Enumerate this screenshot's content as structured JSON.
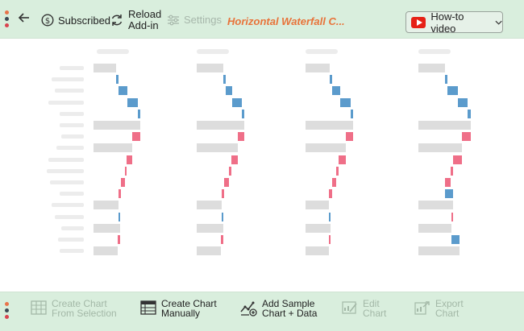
{
  "toolbar": {
    "subscribed_label": "Subscribed",
    "reload_label": "Reload Add-in",
    "settings_label": "Settings",
    "chart_title": "Horizontal Waterfall C...",
    "howto_label": "How-to video"
  },
  "bottom_toolbar": {
    "create_from_selection": {
      "line1": "Create Chart",
      "line2": "From Selection"
    },
    "create_manually": {
      "line1": "Create Chart",
      "line2": "Manually"
    },
    "add_sample": {
      "line1": "Add Sample",
      "line2": "Chart + Data"
    },
    "edit_chart": {
      "line1": "Edit",
      "line2": "Chart"
    },
    "export_chart": {
      "line1": "Export",
      "line2": "Chart"
    }
  },
  "colors": {
    "toolbar_bg": "#d9eedd",
    "accent_title": "#e8733a",
    "total_bar": "#dddddd",
    "increase_bar": "#5b9bcc",
    "decrease_bar": "#ef6f88",
    "youtube_red": "#e62117"
  },
  "chart_data": [
    {
      "type": "bar",
      "subtype": "horizontal-waterfall",
      "title": "",
      "rows": [
        {
          "kind": "total",
          "value": 28
        },
        {
          "kind": "increase",
          "value": 3
        },
        {
          "kind": "increase",
          "value": 11
        },
        {
          "kind": "increase",
          "value": 13
        },
        {
          "kind": "increase",
          "value": 3
        },
        {
          "kind": "total",
          "value": 58
        },
        {
          "kind": "decrease",
          "value": 10
        },
        {
          "kind": "total",
          "value": 48
        },
        {
          "kind": "decrease",
          "value": 7
        },
        {
          "kind": "decrease",
          "value": 2
        },
        {
          "kind": "decrease",
          "value": 5
        },
        {
          "kind": "decrease",
          "value": 3
        },
        {
          "kind": "total",
          "value": 31
        },
        {
          "kind": "increase",
          "value": 2
        },
        {
          "kind": "total",
          "value": 33
        },
        {
          "kind": "decrease",
          "value": 3
        },
        {
          "kind": "total",
          "value": 30
        }
      ]
    },
    {
      "type": "bar",
      "subtype": "horizontal-waterfall",
      "title": "",
      "rows": [
        {
          "kind": "total",
          "value": 33
        },
        {
          "kind": "increase",
          "value": 3
        },
        {
          "kind": "increase",
          "value": 8
        },
        {
          "kind": "increase",
          "value": 12
        },
        {
          "kind": "increase",
          "value": 3
        },
        {
          "kind": "total",
          "value": 59
        },
        {
          "kind": "decrease",
          "value": 8
        },
        {
          "kind": "total",
          "value": 51
        },
        {
          "kind": "decrease",
          "value": 8
        },
        {
          "kind": "decrease",
          "value": 3
        },
        {
          "kind": "decrease",
          "value": 6
        },
        {
          "kind": "decrease",
          "value": 3
        },
        {
          "kind": "total",
          "value": 31
        },
        {
          "kind": "increase",
          "value": 2
        },
        {
          "kind": "total",
          "value": 33
        },
        {
          "kind": "decrease",
          "value": 3
        },
        {
          "kind": "total",
          "value": 30
        }
      ]
    },
    {
      "type": "bar",
      "subtype": "horizontal-waterfall",
      "title": "",
      "rows": [
        {
          "kind": "total",
          "value": 30
        },
        {
          "kind": "increase",
          "value": 3
        },
        {
          "kind": "increase",
          "value": 10
        },
        {
          "kind": "increase",
          "value": 13
        },
        {
          "kind": "increase",
          "value": 3
        },
        {
          "kind": "total",
          "value": 59
        },
        {
          "kind": "decrease",
          "value": 9
        },
        {
          "kind": "total",
          "value": 50
        },
        {
          "kind": "decrease",
          "value": 9
        },
        {
          "kind": "decrease",
          "value": 3
        },
        {
          "kind": "decrease",
          "value": 5
        },
        {
          "kind": "decrease",
          "value": 4
        },
        {
          "kind": "total",
          "value": 29
        },
        {
          "kind": "increase",
          "value": 2
        },
        {
          "kind": "total",
          "value": 31
        },
        {
          "kind": "decrease",
          "value": 2
        },
        {
          "kind": "total",
          "value": 29
        }
      ]
    },
    {
      "type": "bar",
      "subtype": "horizontal-waterfall",
      "title": "",
      "rows": [
        {
          "kind": "total",
          "value": 33
        },
        {
          "kind": "increase",
          "value": 3
        },
        {
          "kind": "increase",
          "value": 13
        },
        {
          "kind": "increase",
          "value": 12
        },
        {
          "kind": "increase",
          "value": 4
        },
        {
          "kind": "total",
          "value": 65
        },
        {
          "kind": "decrease",
          "value": 11
        },
        {
          "kind": "total",
          "value": 54
        },
        {
          "kind": "decrease",
          "value": 11
        },
        {
          "kind": "decrease",
          "value": 3
        },
        {
          "kind": "decrease",
          "value": 7
        },
        {
          "kind": "increase",
          "value": 10
        },
        {
          "kind": "total",
          "value": 43
        },
        {
          "kind": "decrease",
          "value": 2
        },
        {
          "kind": "total",
          "value": 41
        },
        {
          "kind": "increase",
          "value": 10
        },
        {
          "kind": "total",
          "value": 51
        }
      ]
    }
  ]
}
